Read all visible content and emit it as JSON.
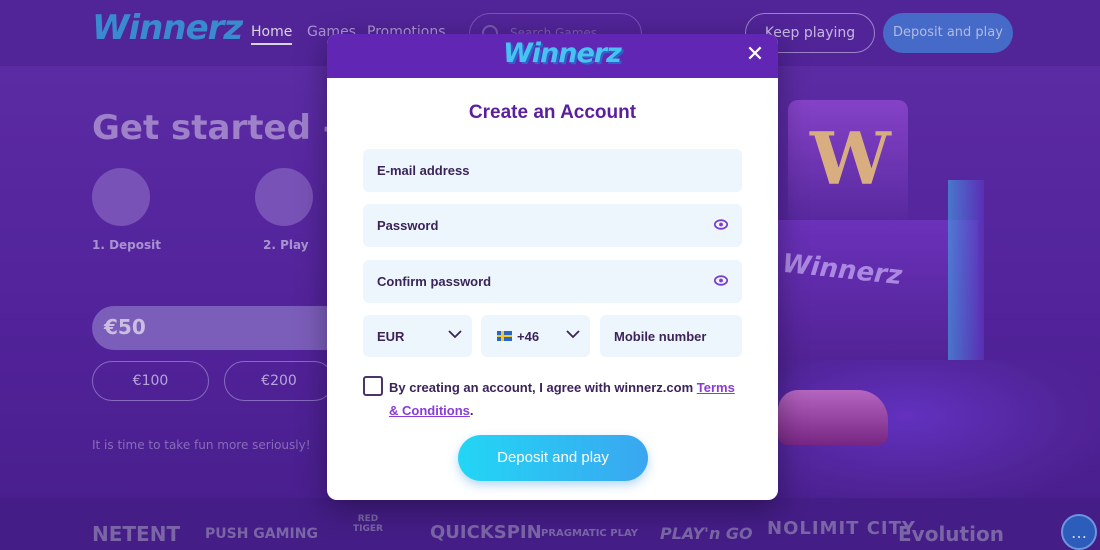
{
  "background": {
    "logo": "Winnerz",
    "nav": {
      "home": "Home",
      "games": "Games",
      "promotions": "Promotions"
    },
    "search_placeholder": "Search Games",
    "keep_playing": "Keep playing",
    "deposit_and_play": "Deposit and play",
    "hero_title": "Get started - i",
    "steps": [
      "1. Deposit",
      "2. Play"
    ],
    "amount_value": "€50",
    "amount_options": [
      "€100",
      "€200"
    ],
    "tagline": "It is time to take fun more seriously!",
    "casino_sign": "W",
    "casino_neon": "Winnerz",
    "providers": [
      "NETENT",
      "PUSH GAMING",
      "RED TIGER",
      "QUICKSPIN",
      "PRAGMATIC PLAY",
      "PLAY'n GO",
      "NOLIMIT CITY",
      "Evolution"
    ]
  },
  "modal": {
    "logo": "Winnerz",
    "close_glyph": "✕",
    "title": "Create an Account",
    "email_label": "E-mail address",
    "password_label": "Password",
    "confirm_label": "Confirm password",
    "currency": "EUR",
    "phone_code": "+46",
    "mobile_label": "Mobile number",
    "terms_text": "By creating an account, I agree with winnerz.com ",
    "terms_link": "Terms & Conditions",
    "terms_end": ".",
    "submit_label": "Deposit and play"
  },
  "colors": {
    "brand_purple": "#6126b3",
    "title_purple": "#5b1f9e",
    "field_bg": "#eef6fd",
    "accent_cyan": "#23d6f5",
    "link": "#8a3bd8"
  }
}
